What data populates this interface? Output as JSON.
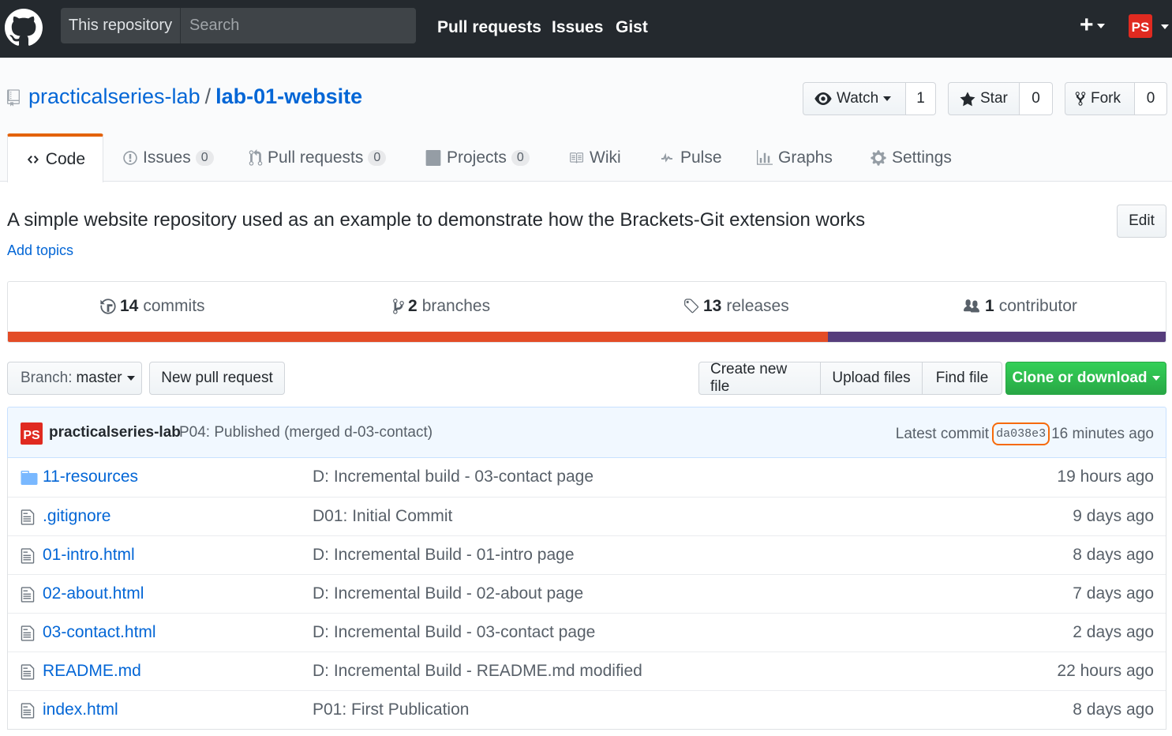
{
  "header": {
    "scope_label": "This repository",
    "search_placeholder": "Search",
    "nav": [
      "Pull requests",
      "Issues",
      "Gist"
    ],
    "plus": "+",
    "avatar_text": "PS"
  },
  "repo": {
    "owner": "practicalseries-lab",
    "separator": "/",
    "name": "lab-01-website",
    "watch_label": "Watch",
    "watch_count": "1",
    "star_label": "Star",
    "star_count": "0",
    "fork_label": "Fork",
    "fork_count": "0"
  },
  "tabs": [
    {
      "label": "Code",
      "icon": "code-icon",
      "selected": true
    },
    {
      "label": "Issues",
      "count": "0",
      "icon": "issue-icon"
    },
    {
      "label": "Pull requests",
      "count": "0",
      "icon": "pull-request-icon"
    },
    {
      "label": "Projects",
      "count": "0",
      "icon": "project-icon"
    },
    {
      "label": "Wiki",
      "icon": "book-icon"
    },
    {
      "label": "Pulse",
      "icon": "pulse-icon"
    },
    {
      "label": "Graphs",
      "icon": "graph-icon"
    },
    {
      "label": "Settings",
      "icon": "gear-icon"
    }
  ],
  "description": "A simple website repository used as an example to demonstrate how the Brackets-Git extension works",
  "add_topics": "Add topics",
  "edit_label": "Edit",
  "summary": {
    "commits_count": "14",
    "commits_label": "commits",
    "branches_count": "2",
    "branches_label": "branches",
    "releases_count": "13",
    "releases_label": "releases",
    "contributors_count": "1",
    "contributors_label": "contributor"
  },
  "languages": [
    {
      "fraction": 0.708,
      "color": "#e34c26"
    },
    {
      "fraction": 0.292,
      "color": "#563d7c"
    }
  ],
  "file_nav": {
    "branch_prefix": "Branch:",
    "branch_name": "master",
    "new_pr": "New pull request",
    "create_file": "Create new file",
    "upload_files": "Upload files",
    "find_file": "Find file",
    "clone": "Clone or download"
  },
  "commit": {
    "author": "practicalseries-lab",
    "message": "P04: Published (merged d-03-contact)",
    "latest_label": "Latest commit",
    "sha": "da038e3",
    "age": "16 minutes ago"
  },
  "files": [
    {
      "name": "11-resources",
      "type": "dir",
      "message": "D: Incremental build - 03-contact page",
      "age": "19 hours ago"
    },
    {
      "name": ".gitignore",
      "type": "file",
      "message": "D01: Initial Commit",
      "age": "9 days ago"
    },
    {
      "name": "01-intro.html",
      "type": "file",
      "message": "D: Incremental Build - 01-intro page",
      "age": "8 days ago"
    },
    {
      "name": "02-about.html",
      "type": "file",
      "message": "D: Incremental Build - 02-about page",
      "age": "7 days ago"
    },
    {
      "name": "03-contact.html",
      "type": "file",
      "message": "D: Incremental Build - 03-contact page",
      "age": "2 days ago"
    },
    {
      "name": "README.md",
      "type": "file",
      "message": "D: Incremental Build - README.md modified",
      "age": "22 hours ago"
    },
    {
      "name": "index.html",
      "type": "file",
      "message": "P01: First Publication",
      "age": "8 days ago"
    }
  ]
}
